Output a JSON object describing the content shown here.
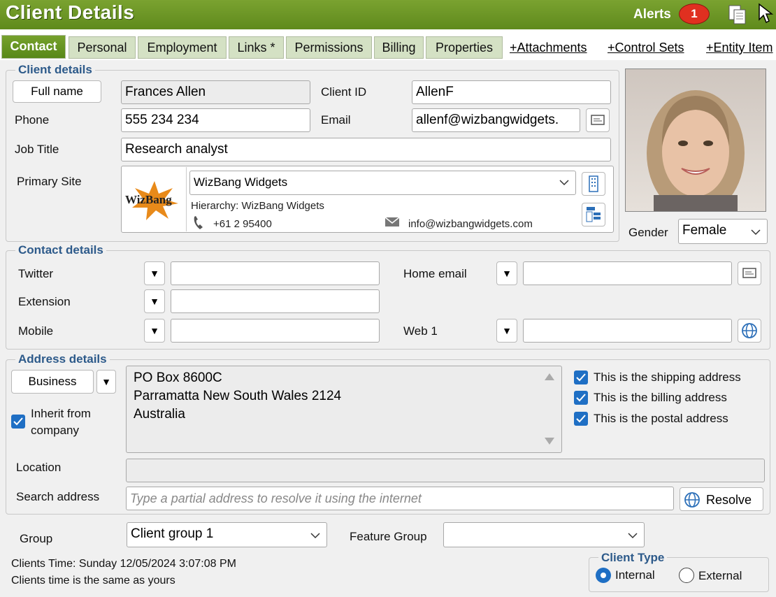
{
  "header": {
    "title": "Client Details",
    "alerts_label": "Alerts",
    "alerts_count": "1"
  },
  "tabs": [
    "Contact",
    "Personal",
    "Employment",
    "Links *",
    "Permissions",
    "Billing",
    "Properties"
  ],
  "tab_links": [
    "+Attachments",
    "+Control Sets",
    "+Entity Item"
  ],
  "client_details": {
    "legend": "Client details",
    "full_name_button": "Full name",
    "full_name": "Frances Allen",
    "client_id_label": "Client ID",
    "client_id": "AllenF",
    "phone_label": "Phone",
    "phone": "555 234 234",
    "email_label": "Email",
    "email": "allenf@wizbangwidgets.",
    "job_title_label": "Job Title",
    "job_title": "Research analyst",
    "primary_site_label": "Primary Site",
    "site_name": "WizBang Widgets",
    "hierarchy": "Hierarchy: WizBang Widgets",
    "site_phone": "+61 2 95400",
    "site_email": "info@wizbangwidgets.com",
    "logo_text": "WizBang",
    "gender_label": "Gender",
    "gender": "Female"
  },
  "contact_details": {
    "legend": "Contact details",
    "twitter_label": "Twitter",
    "extension_label": "Extension",
    "mobile_label": "Mobile",
    "home_email_label": "Home email",
    "web_label": "Web 1"
  },
  "address_details": {
    "legend": "Address details",
    "type": "Business",
    "inherit_label_1": "Inherit from",
    "inherit_label_2": "company",
    "address_line_1": "PO Box 8600C",
    "address_line_2": "Parramatta New South Wales 2124",
    "address_line_3": "Australia",
    "shipping_label": "This is the shipping address",
    "billing_label": "This is the billing address",
    "postal_label": "This is the postal address",
    "location_label": "Location",
    "search_label": "Search address",
    "search_placeholder": "Type a partial address to resolve it using the internet",
    "resolve_button": "Resolve"
  },
  "footer": {
    "group_label": "Group",
    "group_value": "Client group 1",
    "feature_group_label": "Feature Group",
    "clients_time": "Clients Time: Sunday 12/05/2024 3:07:08 PM",
    "time_same": "Clients time is the same as yours",
    "client_type_legend": "Client Type",
    "internal_label": "Internal",
    "external_label": "External"
  },
  "colors": {
    "titlebar": "#6a9624",
    "legend": "#2d5a8a",
    "check": "#1f6fc4",
    "badge": "#e03020"
  }
}
